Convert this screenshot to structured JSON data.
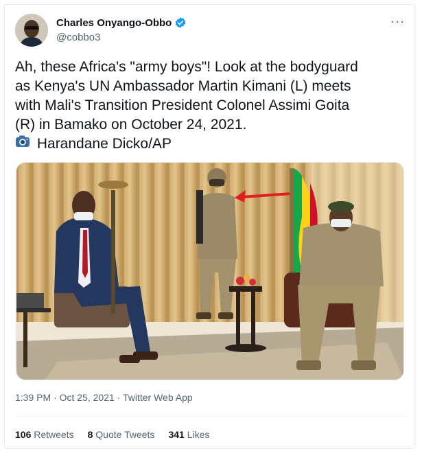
{
  "author": {
    "display_name": "Charles Onyango-Obbo",
    "handle": "@cobbo3",
    "verified": true
  },
  "tweet": {
    "lines": [
      "Ah, these Africa's \"army boys\"! Look at the bodyguard",
      "as Kenya's UN Ambassador Martin Kimani (L) meets",
      "with Mali's Transition President Colonel Assimi Goita",
      "(R) in Bamako on October 24, 2021."
    ],
    "credit": "Harandane Dicko/AP",
    "credit_icon": "camera-icon"
  },
  "meta": {
    "time": "1:39 PM",
    "separator1": "·",
    "date": "Oct 25, 2021",
    "separator2": "·",
    "source": "Twitter Web App"
  },
  "stats": {
    "retweets_count": "106",
    "retweets_label": "Retweets",
    "quotes_count": "8",
    "quotes_label": "Quote Tweets",
    "likes_count": "341",
    "likes_label": "Likes"
  },
  "icons": {
    "more": "more-dots-icon",
    "verified": "verified-badge-icon"
  },
  "colors": {
    "verified_blue": "#1d9bf0",
    "secondary_text": "#536471",
    "arrow_red": "#e11d1d"
  }
}
